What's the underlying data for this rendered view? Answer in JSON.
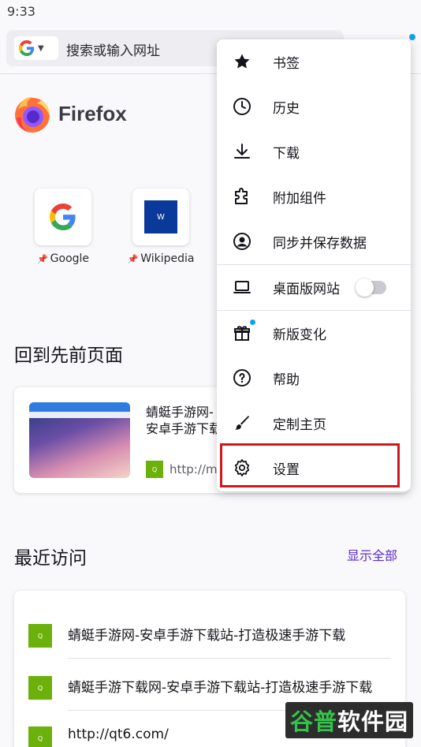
{
  "status_bar": {
    "time": "9:33"
  },
  "toolbar": {
    "search_placeholder": "搜索或输入网址",
    "search_engine_icon": "google-g-icon"
  },
  "brand": {
    "name": "Firefox",
    "logo_icon": "firefox-logo-icon"
  },
  "shortcuts": [
    {
      "label": "Google",
      "icon": "google-g-icon",
      "pinned": true
    },
    {
      "label": "Wikipedia",
      "icon": "wikipedia-w-icon",
      "tile_text": "W",
      "pinned": true
    }
  ],
  "jump_back": {
    "heading": "回到先前页面",
    "card": {
      "title": "蜻蜓手游网-安卓手游下载",
      "url": "http://m.",
      "favicon_text": "Q"
    }
  },
  "recent": {
    "heading": "最近访问",
    "show_all": "显示全部",
    "items": [
      {
        "title": "蜻蜓手游网-安卓手游下载站-打造极速手游下载",
        "favicon_text": "Q"
      },
      {
        "title": "蜻蜓手游下载网-安卓手游下载站-打造极速手游下载",
        "favicon_text": "Q"
      },
      {
        "title": "http://qt6.com/",
        "favicon_text": "Q"
      }
    ]
  },
  "menu": {
    "items": [
      {
        "label": "书签",
        "icon": "star-icon"
      },
      {
        "label": "历史",
        "icon": "clock-icon"
      },
      {
        "label": "下载",
        "icon": "download-icon"
      },
      {
        "label": "附加组件",
        "icon": "puzzle-icon"
      },
      {
        "label": "同步并保存数据",
        "icon": "account-icon"
      },
      {
        "label": "桌面版网站",
        "icon": "laptop-icon",
        "toggle": false
      },
      {
        "label": "新版变化",
        "icon": "gift-icon",
        "badge": true
      },
      {
        "label": "帮助",
        "icon": "help-icon"
      },
      {
        "label": "定制主页",
        "icon": "paintbrush-icon"
      },
      {
        "label": "设置",
        "icon": "gear-icon",
        "highlighted": true
      }
    ]
  },
  "watermark": {
    "part1": "谷普",
    "part2": "软件园"
  },
  "colors": {
    "accent_purple": "#592acb",
    "notification_blue": "#0fa2ec",
    "highlight_red": "#d0181c",
    "favicon_green": "#6cb10b",
    "wikipedia_blue": "#0a3a99"
  }
}
